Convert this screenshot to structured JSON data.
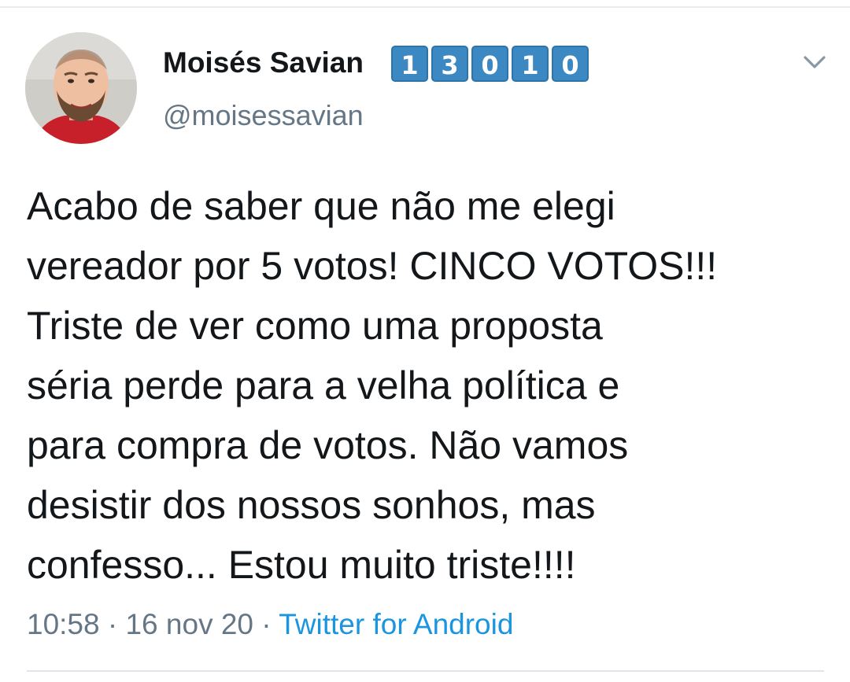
{
  "tweet": {
    "display_name": "Moisés Savian",
    "name_badge_digits": [
      "1",
      "3",
      "0",
      "1",
      "0"
    ],
    "handle": "@moisessavian",
    "text_lines": [
      "Acabo de saber que não me elegi",
      "vereador por 5 votos! CINCO VOTOS!!!",
      "Triste de ver como uma proposta",
      "séria perde para a velha política e",
      "para compra de votos. Não vamos",
      "desistir dos nossos sonhos, mas",
      "confesso... Estou muito triste!!!!"
    ],
    "time": "10:58",
    "separator": "·",
    "date": "16 nov 20",
    "source": "Twitter for Android"
  },
  "icons": {
    "menu": "chevron-down-icon",
    "avatar": "profile-photo"
  },
  "colors": {
    "text_primary": "#14171a",
    "text_secondary": "#657786",
    "link": "#1b95e0",
    "badge_blue": "#3b88c3",
    "divider": "#e6ecf0"
  }
}
